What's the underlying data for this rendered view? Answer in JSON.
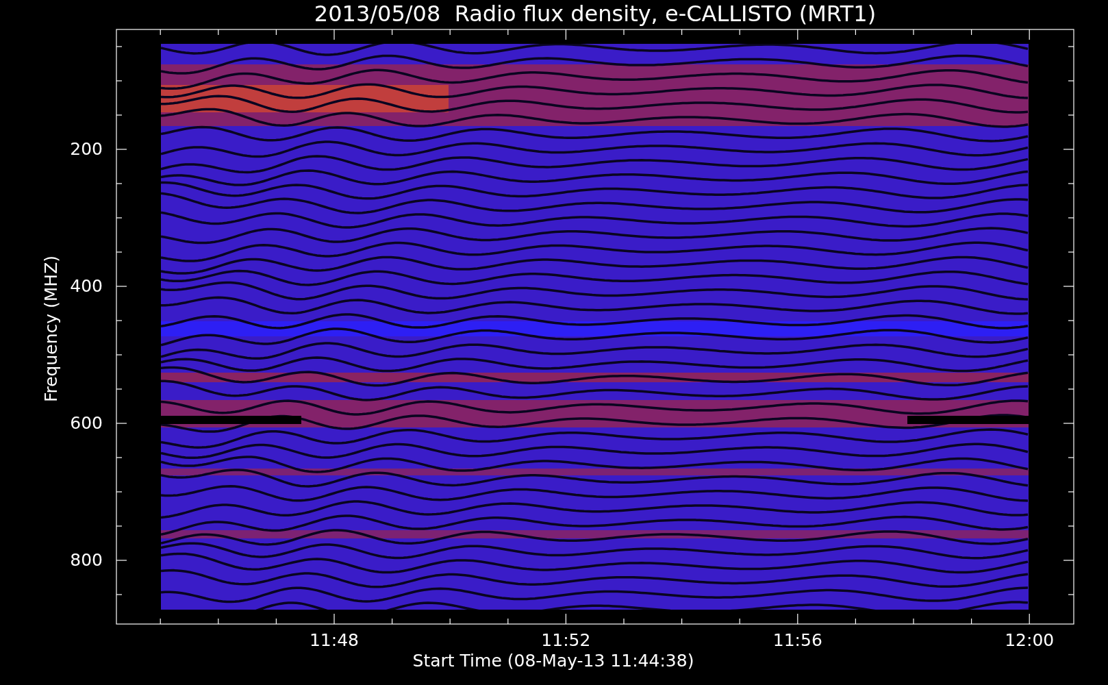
{
  "title": "2013/05/08  Radio flux density, e-CALLISTO (MRT1)",
  "y_axis": {
    "label": "Frequency (MHZ)",
    "tick_labels": [
      "200",
      "400",
      "600",
      "800"
    ]
  },
  "x_axis": {
    "label": "Start Time (08-May-13 11:44:38)",
    "tick_labels": [
      "11:48",
      "11:52",
      "11:56",
      "12:00"
    ]
  }
}
